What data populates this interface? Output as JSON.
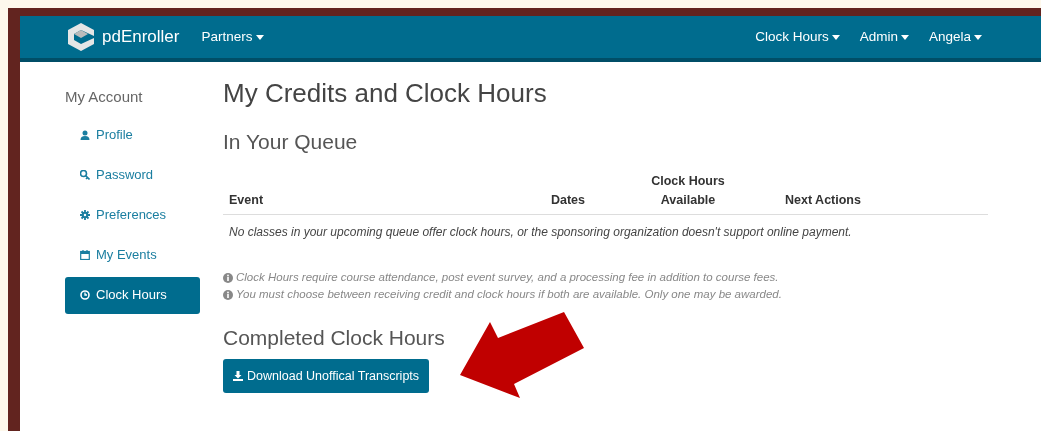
{
  "navbar": {
    "brand": "pdEnroller",
    "left_menus": [
      {
        "label": "Partners"
      }
    ],
    "right_menus": [
      {
        "label": "Clock Hours"
      },
      {
        "label": "Admin"
      },
      {
        "label": "Angela"
      }
    ]
  },
  "sidebar": {
    "heading": "My Account",
    "items": [
      {
        "label": "Profile",
        "selected": false
      },
      {
        "label": "Password",
        "selected": false
      },
      {
        "label": "Preferences",
        "selected": false
      },
      {
        "label": "My Events",
        "selected": false
      },
      {
        "label": "Clock Hours",
        "selected": true
      }
    ]
  },
  "page_title": "My Credits and Clock Hours",
  "queue": {
    "heading": "In Your Queue",
    "columns": [
      {
        "lines": [
          "Event"
        ]
      },
      {
        "lines": [
          "Dates"
        ]
      },
      {
        "lines": [
          "Clock Hours",
          "Available"
        ]
      },
      {
        "lines": [
          "Next Actions"
        ]
      }
    ],
    "empty_message": "No classes in your upcoming queue offer clock hours, or the sponsoring organization doesn't support online payment.",
    "notes": [
      "Clock Hours require course attendance, post event survey, and a processing fee in addition to course fees.",
      "You must choose between receiving credit and clock hours if both are available. Only one may be awarded."
    ]
  },
  "completed": {
    "heading": "Completed Clock Hours",
    "button": "Download Unoffical Transcripts"
  }
}
